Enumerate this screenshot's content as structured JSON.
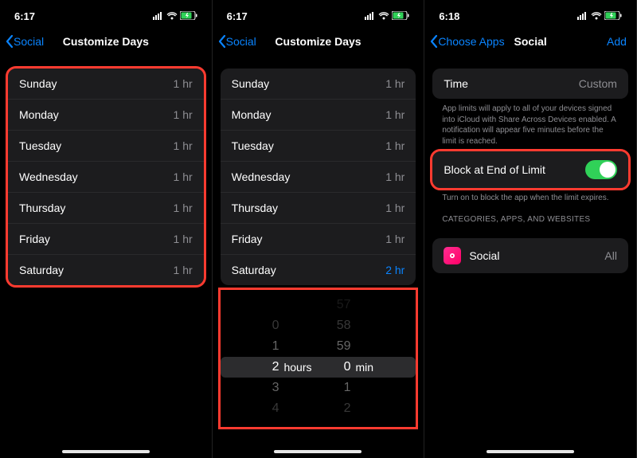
{
  "status": {
    "t1": "6:17",
    "t2": "6:17",
    "t3": "6:18"
  },
  "nav": {
    "back1": "Social",
    "title1": "Customize Days",
    "back2": "Social",
    "title2": "Customize Days",
    "back3": "Choose Apps",
    "title3": "Social",
    "add": "Add"
  },
  "days": {
    "sun": "Sunday",
    "mon": "Monday",
    "tue": "Tuesday",
    "wed": "Wednesday",
    "thu": "Thursday",
    "fri": "Friday",
    "sat": "Saturday",
    "v1": "1 hr",
    "v2": "2 hr"
  },
  "p3": {
    "time_label": "Time",
    "time_val": "Custom",
    "note": "App limits will apply to all of your devices signed into iCloud with Share Across Devices enabled. A notification will appear five minutes before the limit is reached.",
    "block": "Block at End of Limit",
    "block_note": "Turn on to block the app when the limit expires.",
    "cat_header": "Categories, Apps, and Websites",
    "social": "Social",
    "all": "All"
  },
  "picker": {
    "hr_m2": "",
    "hr_m1": "0",
    "hr_0": "1",
    "hr_sel": "2",
    "hr_p1": "3",
    "hr_p2": "4",
    "mn_m2": "57",
    "mn_m1": "58",
    "mn_0": "59",
    "mn_sel": "0",
    "mn_p1": "1",
    "mn_p2": "2",
    "hlabel": "hours",
    "mlabel": "min"
  }
}
